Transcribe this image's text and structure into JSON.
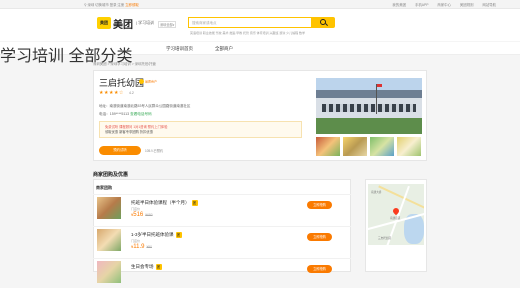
{
  "topbar": {
    "location": "深圳",
    "switch_city": "切换城市",
    "login": "登录",
    "register": "注册",
    "highlight": "立即领取",
    "right_items": [
      "我的美团",
      "手机APP",
      "商家中心",
      "美团规则",
      "网站导航"
    ]
  },
  "header": {
    "logo_mark": "美团",
    "logo_text": "美团",
    "subtitle": "| 学习培训",
    "city_select": "深圳全部▾",
    "search_placeholder": "搜索商家或地点",
    "hotwords": "英语培训  职业技能  驾校  美术  舞蹈  早教  托管  音乐  体育培训  兴趣班  游泳  少儿编程  数学"
  },
  "nav": {
    "category": "学习培训 全部分类",
    "links": [
      "学习培训首页",
      "全部商户"
    ]
  },
  "breadcrumb": "深圳美团 > 深圳学习培训 > 深圳托班/托管",
  "shop": {
    "name": "三启托幼园",
    "badge": "品质商户",
    "stars": "★★★★☆",
    "score": "4.2",
    "address": "地址：南澳街道南澳北路53号人民群众公园路街道南澳社区",
    "phone_label": "电话：",
    "phone": "159****5113",
    "phone_extra": "查看电话号码",
    "perk_line1": "免费试听  课程顾问 1对1咨询 预约上门体验",
    "perk_line2": "领取优惠  新客专享团购 折扣优惠",
    "visit_button": "预约试听",
    "visitors": "105人已预约"
  },
  "section_title": "商家团购及优惠",
  "group_head": "商家团购",
  "deals": [
    {
      "name": "托班半日体验课程（半个月）",
      "tag": "团",
      "meta": "门店价",
      "price": "516",
      "orig": "¥680",
      "buy": "立即抢购"
    },
    {
      "name": "1-3岁半日托班体验课",
      "tag": "团",
      "meta": "门店价",
      "price": "11.9",
      "orig": "¥90",
      "buy": "立即抢购"
    },
    {
      "name": "生日会专场",
      "tag": "团",
      "meta": "",
      "price": "",
      "orig": "",
      "buy": "立即抢购"
    }
  ],
  "map": {
    "labels": [
      "南澳大桥",
      "南澳街道",
      "三启托幼园"
    ]
  },
  "colors": {
    "brand_yellow": "#ffc300",
    "accent_orange": "#fa7a00",
    "nav_green": "#52b26b"
  }
}
